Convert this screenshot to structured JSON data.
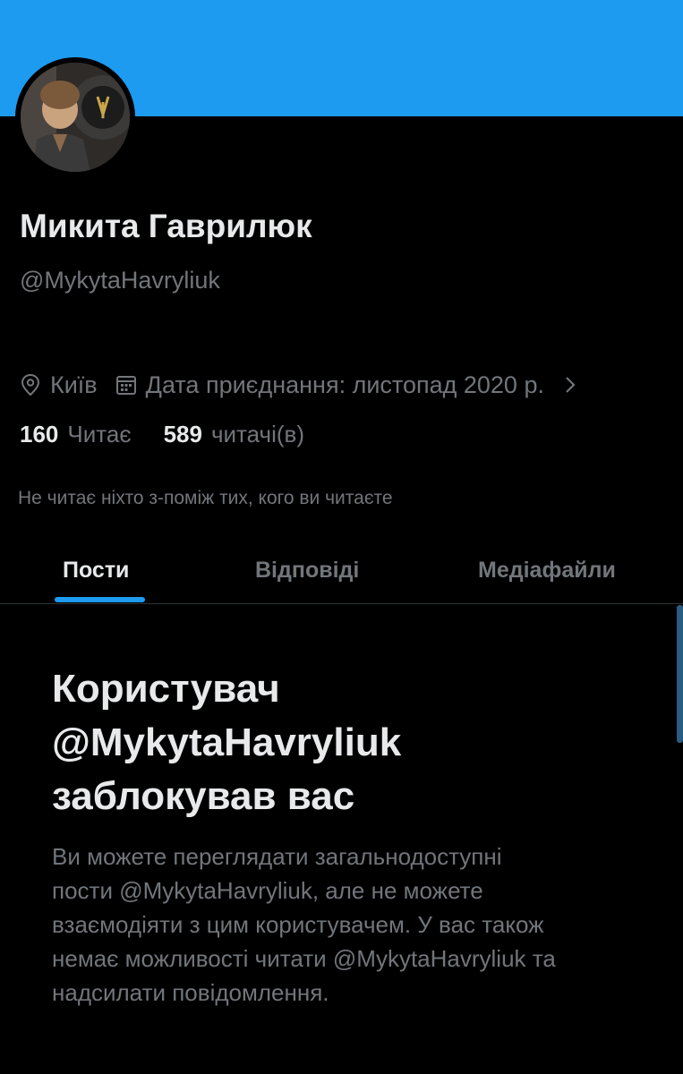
{
  "colors": {
    "banner": "#1d9bf0",
    "background": "#000000",
    "primary_text": "#e7e9ea",
    "secondary_text": "#71767b",
    "accent": "#1d9bf0"
  },
  "profile": {
    "display_name": "Микита Гаврилюк",
    "handle": "@MykytaHavryliuk",
    "avatar": "user-avatar-photo",
    "location": "Київ",
    "location_icon": "location-pin-icon",
    "joined": "Дата приєднання: листопад 2020 р.",
    "joined_icon": "calendar-icon",
    "more_icon": "chevron-right-icon"
  },
  "stats": {
    "following_count": "160",
    "following_label": "Читає",
    "followers_count": "589",
    "followers_label": "читачі(в)"
  },
  "followed_by_note": "Не читає ніхто з-поміж тих, кого ви читаєте",
  "tabs": [
    {
      "label": "Пости",
      "active": true
    },
    {
      "label": "Відповіді",
      "active": false
    },
    {
      "label": "Медіафайли",
      "active": false
    }
  ],
  "blocked_notice": {
    "title_lines": [
      "Користувач",
      "@MykytaHavryliuk",
      "заблокував вас"
    ],
    "body_lines": [
      "Ви можете переглядати загальнодоступні",
      "пости @MykytaHavryliuk, але не можете",
      "взаємодіяти з цим користувачем. У вас також",
      "немає можливості читати @MykytaHavryliuk та",
      "надсилати повідомлення."
    ]
  }
}
